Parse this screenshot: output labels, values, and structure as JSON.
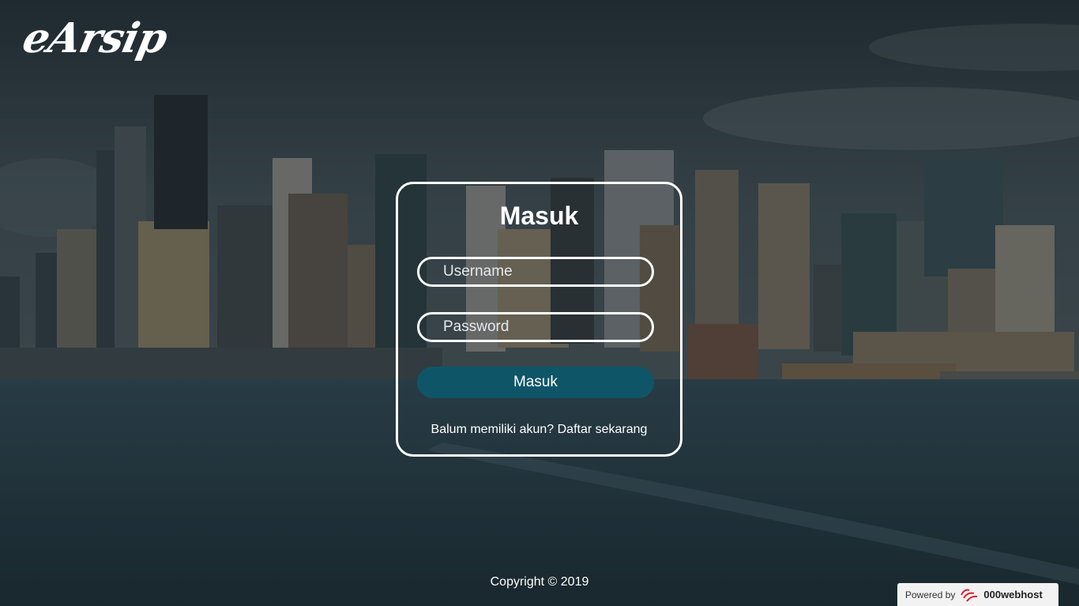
{
  "app": {
    "logo_text": "eArsip"
  },
  "login": {
    "title": "Masuk",
    "username_placeholder": "Username",
    "password_placeholder": "Password",
    "submit_label": "Masuk",
    "register_prompt": "Balum memiliki akun?",
    "register_link": "Daftar sekarang"
  },
  "footer": {
    "copyright": "Copyright © 2019"
  },
  "badge": {
    "prefix": "Powered by",
    "brand": "000webhost",
    "icon": "000webhost-logo-icon"
  },
  "colors": {
    "accent": "#0f5568",
    "overlay": "#1f2a30"
  }
}
